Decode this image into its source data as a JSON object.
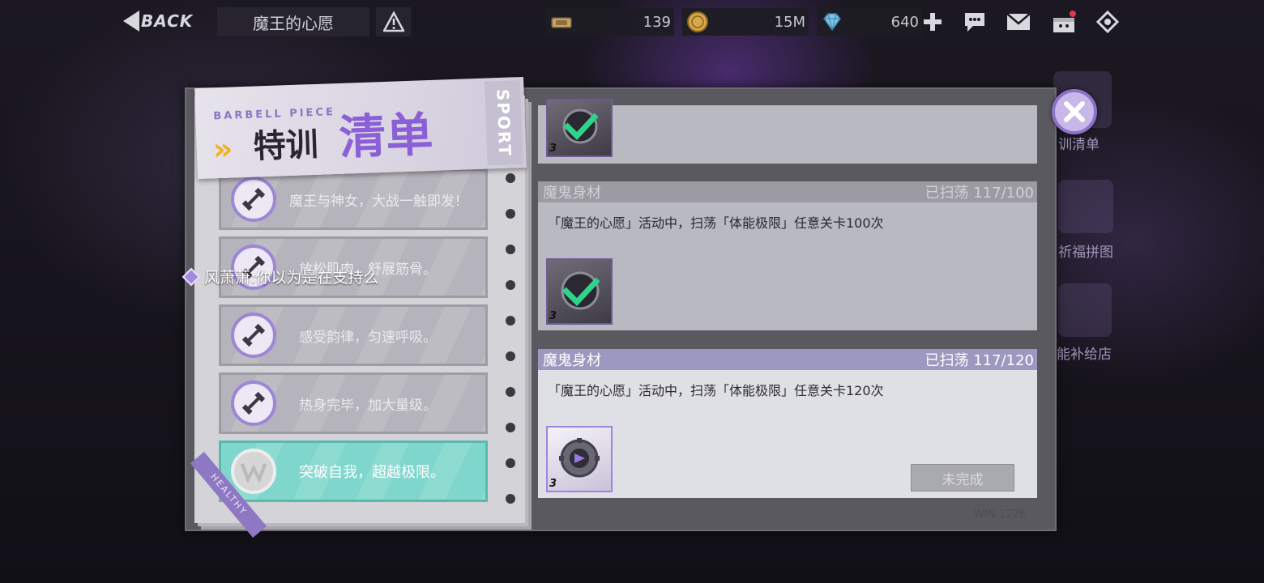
{
  "topbar": {
    "back_label": "BACK",
    "title": "魔王的心愿",
    "resources": [
      {
        "icon": "ticket-icon",
        "value": "139"
      },
      {
        "icon": "coin-icon",
        "value": "15M"
      },
      {
        "icon": "diamond-icon",
        "value": "640"
      }
    ],
    "icons": [
      "add-icon",
      "chat-icon",
      "mail-icon",
      "gift-icon",
      "menu-icon"
    ]
  },
  "side": {
    "items": [
      {
        "label": "训清单"
      },
      {
        "label": "祈福拼图"
      },
      {
        "label": "能补给店"
      }
    ]
  },
  "header": {
    "brand": "BARBELL PIECE",
    "title_a": "特训",
    "title_b": "清单",
    "side_tag": "SPORT",
    "ribbon": "HEALTHY"
  },
  "list": {
    "items": [
      {
        "label": "魔王与神女，大战一触即发！"
      },
      {
        "label": "放松肌肉，舒展筋骨。"
      },
      {
        "label": "感受韵律，匀速呼吸。"
      },
      {
        "label": "热身完毕，加大量级。"
      },
      {
        "label": "突破自我，超越极限。"
      }
    ]
  },
  "chat": {
    "text": "风萧萧:你以为是在支持么"
  },
  "tasks": [
    {
      "title": "魔鬼身材",
      "progress": "已扫荡 117/100",
      "desc": "「魔王的心愿」活动中，扫荡「体能极限」任意关卡100次",
      "reward_count": "3"
    },
    {
      "title": "魔鬼身材",
      "progress": "已扫荡 117/120",
      "desc": "「魔王的心愿」活动中，扫荡「体能极限」任意关卡120次",
      "reward_count": "3",
      "status": "未完成"
    }
  ],
  "top_reward_count": "3",
  "win_label": "WIN:1226",
  "colors": {
    "accent_purple": "#8b5fd6",
    "active_teal": "#7fd6cc",
    "check_green": "#2fd48a"
  }
}
